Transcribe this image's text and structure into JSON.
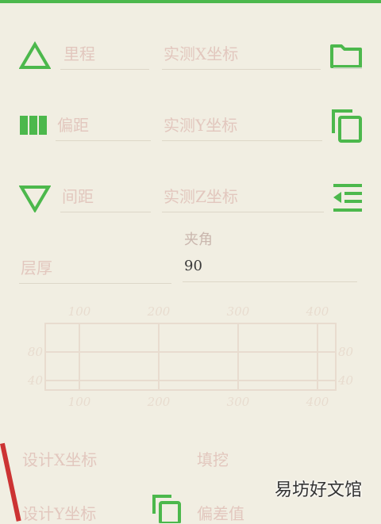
{
  "row1": {
    "field1_placeholder": "里程",
    "field2_placeholder": "实测X坐标",
    "icon": "folder-icon"
  },
  "row2": {
    "field1_placeholder": "偏距",
    "field2_placeholder": "实测Y坐标",
    "icon": "copy-icon"
  },
  "row3": {
    "field1_placeholder": "间距",
    "field2_placeholder": "实测Z坐标",
    "icon": "indent-icon"
  },
  "row4": {
    "thickness_placeholder": "层厚",
    "angle_label": "夹角",
    "angle_value": "90"
  },
  "chart_data": {
    "type": "line",
    "x_ticks": [
      "100",
      "200",
      "300",
      "400"
    ],
    "y_ticks": [
      "80",
      "40"
    ],
    "series": []
  },
  "bottom": {
    "design_x_label": "设计X坐标",
    "fill_cut_label": "填挖",
    "design_y_label": "设计Y坐标",
    "partial_label": "偏差值"
  },
  "watermark": "易坊好文馆",
  "colors": {
    "accent": "#4cb84c",
    "background": "#f1eee2"
  }
}
